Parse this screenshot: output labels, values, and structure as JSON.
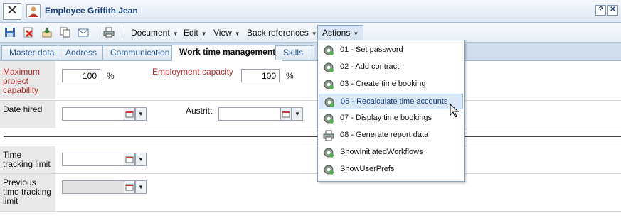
{
  "window": {
    "title": "Employee Griffith Jean",
    "help_label": "?",
    "close_label": "✕"
  },
  "toolbar": {
    "icons": [
      "save-icon",
      "delete-icon",
      "import-icon",
      "copy-icon",
      "mail-icon",
      "print-icon"
    ],
    "menus": [
      "Document",
      "Edit",
      "View",
      "Back references",
      "Actions"
    ],
    "active_menu": "Actions"
  },
  "tabs": [
    "Master data",
    "Address",
    "Communication",
    "Work time management",
    "Skills"
  ],
  "active_tab": "Work time management",
  "form": {
    "max_capability_label": "Maximum project capability",
    "max_capability_value": "100",
    "percent_symbol": "%",
    "employment_capacity_label": "Employment capacity",
    "employment_capacity_value": "100",
    "date_hired_label": "Date hired",
    "austritt_label": "Austritt",
    "time_tracking_limit_label": "Time tracking limit",
    "prev_time_tracking_limit_label": "Previous time tracking limit"
  },
  "actions_menu": [
    {
      "label": "01 - Set password",
      "icon": "gear-icon"
    },
    {
      "label": "02 - Add contract",
      "icon": "gear-icon"
    },
    {
      "label": "03 - Create time booking",
      "icon": "gear-icon"
    },
    {
      "label": "05 - Recalculate time accounts",
      "icon": "gear-icon",
      "hover": true
    },
    {
      "label": "07 - Display time bookings",
      "icon": "gear-icon"
    },
    {
      "label": "08 - Generate report data",
      "icon": "printer-icon"
    },
    {
      "label": "ShowInitiatedWorkflows",
      "icon": "gear-icon"
    },
    {
      "label": "ShowUserPrefs",
      "icon": "gear-icon"
    }
  ],
  "colors": {
    "accent": "#1b3f7a",
    "label_red": "#b52a2a",
    "hover_bg": "#dbe8f7"
  }
}
